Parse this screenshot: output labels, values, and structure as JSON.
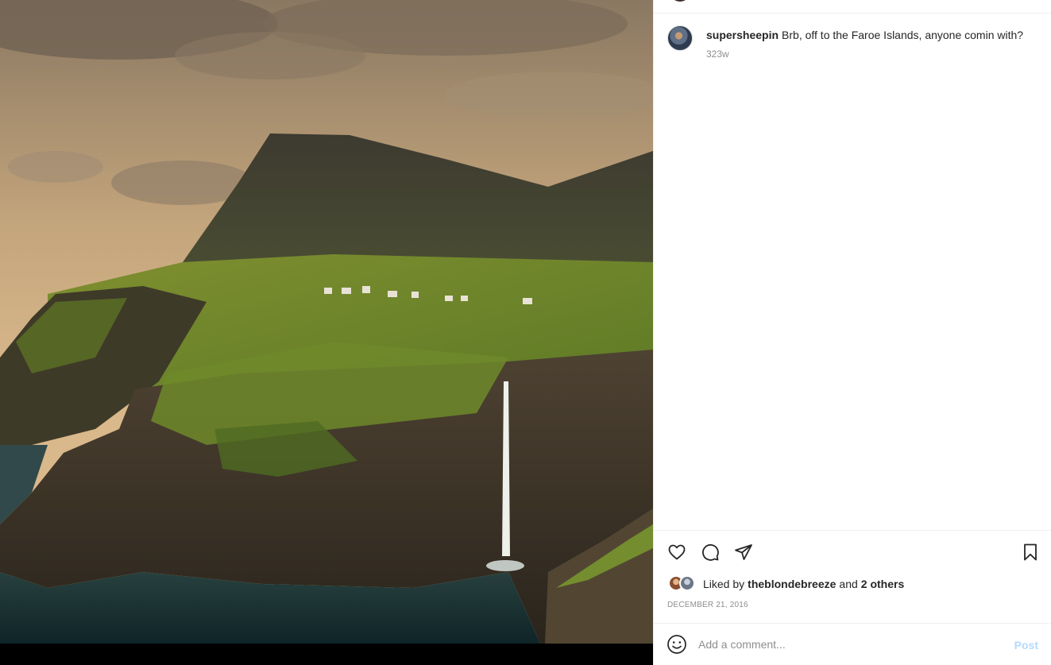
{
  "post": {
    "username": "supersheepin",
    "caption": "Brb, off to the Faroe Islands, anyone comin with?",
    "age": "323w",
    "image_subject": "faroe-islands-waterfall-cliff-photo"
  },
  "actions": {
    "like_icon": "heart-icon",
    "comment_icon": "comment-icon",
    "share_icon": "send-icon",
    "save_icon": "bookmark-icon"
  },
  "likes": {
    "prefix": "Liked by",
    "liker": "theblondebreeze",
    "connector": "and",
    "others": "2 others"
  },
  "date": "DECEMBER 21, 2016",
  "comment_box": {
    "placeholder": "Add a comment...",
    "post_label": "Post",
    "emoji_icon": "emoji-icon"
  },
  "colors": {
    "post_button_disabled": "#b3dbff",
    "secondary_text": "#8e8e8e",
    "primary_text": "#262626",
    "divider": "#efefef"
  }
}
